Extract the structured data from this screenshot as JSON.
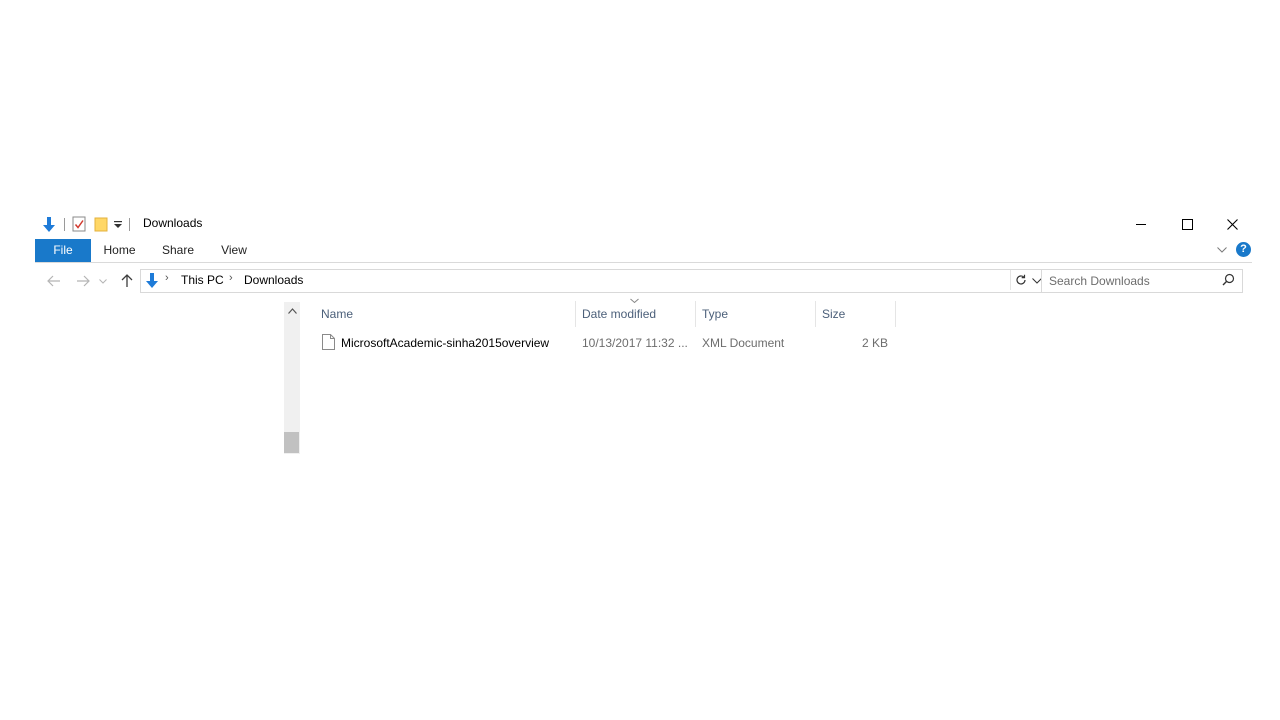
{
  "window": {
    "title": "Downloads",
    "colors": {
      "accent": "#1979ca",
      "header_text": "#4c607a",
      "muted_text": "#6d6d6d"
    }
  },
  "quick_access": [
    {
      "icon": "download-arrow-icon"
    },
    {
      "icon": "properties-icon"
    },
    {
      "icon": "new-folder-icon"
    },
    {
      "icon": "customize-toolbar-icon"
    }
  ],
  "ribbon": {
    "tabs": [
      {
        "id": "file",
        "label": "File"
      },
      {
        "id": "home",
        "label": "Home"
      },
      {
        "id": "share",
        "label": "Share"
      },
      {
        "id": "view",
        "label": "View"
      }
    ],
    "help_label": "?"
  },
  "address": {
    "crumbs": [
      "This PC",
      "Downloads"
    ]
  },
  "search": {
    "placeholder": "Search Downloads"
  },
  "columns": [
    {
      "id": "name",
      "label": "Name"
    },
    {
      "id": "date",
      "label": "Date modified"
    },
    {
      "id": "type",
      "label": "Type"
    },
    {
      "id": "size",
      "label": "Size"
    }
  ],
  "files": [
    {
      "name": "MicrosoftAcademic-sinha2015overview",
      "date_modified": "10/13/2017 11:32 ...",
      "type": "XML Document",
      "size": "2 KB"
    }
  ]
}
